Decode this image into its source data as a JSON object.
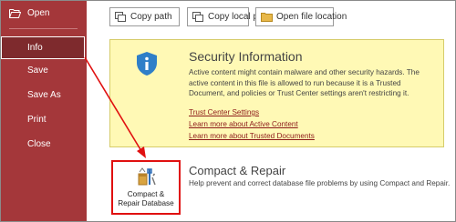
{
  "sidebar": {
    "items": [
      {
        "label": "Open",
        "icon": "folder-open-icon"
      },
      {
        "label": "Info"
      },
      {
        "label": "Save"
      },
      {
        "label": "Save As"
      },
      {
        "label": "Print"
      },
      {
        "label": "Close"
      }
    ],
    "selected": "Info"
  },
  "toolbar": {
    "copy_path": "Copy path",
    "copy_local_path": "Copy local path",
    "open_file_location": "Open file location"
  },
  "security": {
    "title": "Security Information",
    "description": "Active content might contain malware and other security hazards. The active content in this file is allowed to run because it is a Trusted Document, and policies or Trust Center settings aren't restricting it.",
    "links": [
      "Trust Center Settings",
      "Learn more about Active Content",
      "Learn more about Trusted Documents"
    ],
    "icon": "shield-info-icon"
  },
  "compact": {
    "button_line1": "Compact &",
    "button_line2": "Repair Database",
    "title": "Compact & Repair",
    "description": "Help prevent and correct database file problems by using Compact and Repair.",
    "icon": "compact-repair-icon"
  },
  "colors": {
    "sidebar": "#a4373a",
    "sidebar_selected": "#7e2a2d",
    "security_bg": "#fff9b5",
    "highlight": "#e01010",
    "link": "#8c1a1a"
  }
}
